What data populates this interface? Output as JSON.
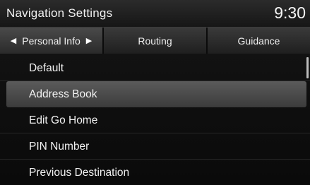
{
  "header": {
    "title": "Navigation Settings",
    "time": "9:30"
  },
  "tabs": [
    {
      "label": "Personal Info",
      "active": true
    },
    {
      "label": "Routing",
      "active": false
    },
    {
      "label": "Guidance",
      "active": false
    }
  ],
  "tab_arrows": {
    "left": "◀",
    "right": "▶"
  },
  "menu": {
    "items": [
      {
        "label": "Default",
        "selected": false
      },
      {
        "label": "Address Book",
        "selected": true
      },
      {
        "label": "Edit Go Home",
        "selected": false
      },
      {
        "label": "PIN Number",
        "selected": false
      },
      {
        "label": "Previous Destination",
        "selected": false
      }
    ]
  }
}
